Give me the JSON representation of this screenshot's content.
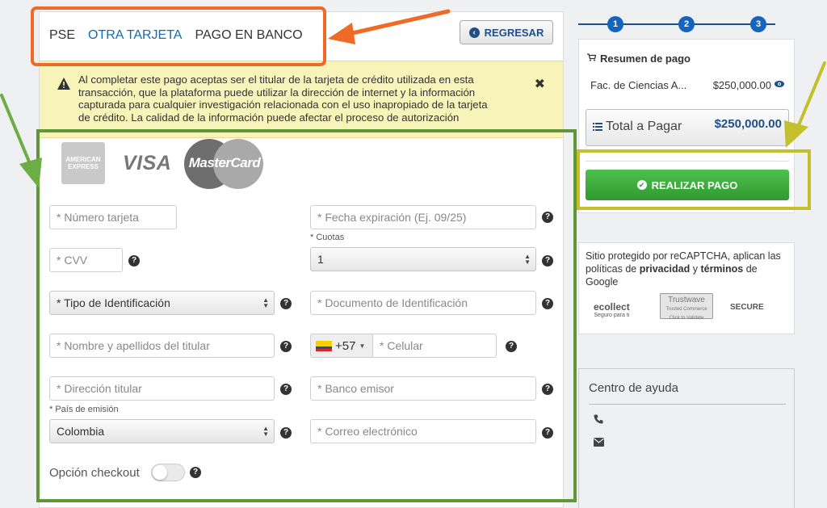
{
  "tabs": [
    {
      "label": "PSE"
    },
    {
      "label": "OTRA TARJETA"
    },
    {
      "label": "PAGO EN BANCO"
    }
  ],
  "back_button": {
    "label": "REGRESAR"
  },
  "notice": {
    "text": "Al completar este pago aceptas ser el titular de la tarjeta de crédito utilizada en esta transacción, que la plataforma puede utilizar la dirección de internet y la información capturada para cualquier investigación relacionada con el uso inapropiado de la tarjeta de crédito. La calidad de la información puede afectar el proceso de autorización"
  },
  "card_logos": {
    "amex": "AMERICAN EXPRESS",
    "visa": "VISA",
    "mastercard": "MasterCard"
  },
  "form": {
    "card_number": {
      "placeholder": "* Número tarjeta"
    },
    "expiry": {
      "placeholder": "* Fecha expiración (Ej. 09/25)"
    },
    "cuotas_label": "* Cuotas",
    "cvv": {
      "placeholder": "* CVV"
    },
    "cuotas": {
      "value": "1"
    },
    "id_type": {
      "value": "* Tipo de Identificación"
    },
    "id_document": {
      "placeholder": "* Documento de Identificación"
    },
    "holder_name": {
      "placeholder": "* Nombre y apellidos del titular"
    },
    "phone_prefix": "+57",
    "cellphone": {
      "placeholder": "* Celular"
    },
    "address": {
      "placeholder": "* Dirección titular"
    },
    "bank": {
      "placeholder": "* Banco emisor"
    },
    "country_label": "* País de emisión",
    "country": {
      "value": "Colombia"
    },
    "email": {
      "placeholder": "* Correo electrónico"
    },
    "checkout_label": "Opción checkout",
    "checkout_enabled": false
  },
  "steps": [
    "1",
    "2",
    "3"
  ],
  "summary": {
    "title": "Resumen de pago",
    "item_name": "Fac. de Ciencias A...",
    "item_amount": "$250,000.00",
    "total_label": "Total a Pagar",
    "total_amount": "$250,000.00",
    "pay_button": "REALIZAR PAGO"
  },
  "captcha": {
    "text_before": "Sitio protegido por reCAPTCHA, aplican las políticas de ",
    "privacy": "privacidad",
    "and": " y ",
    "terms": "términos",
    "text_after": " de Google",
    "badges": {
      "ecollect": "ecollect",
      "ecollect_sub": "Seguro para ti",
      "trustwave": "Trustwave",
      "trustwave_sub": "Trusted Commerce",
      "trustwave_sub2": "Click to Validate",
      "secure": "SECURE"
    }
  },
  "help": {
    "title": "Centro de ayuda"
  },
  "colors": {
    "accent": "#0e6bb7",
    "annotation_orange": "#f06a27",
    "annotation_green": "#5f9638",
    "annotation_olive": "#c3bf2d",
    "pay_green": "#3bad3b"
  }
}
